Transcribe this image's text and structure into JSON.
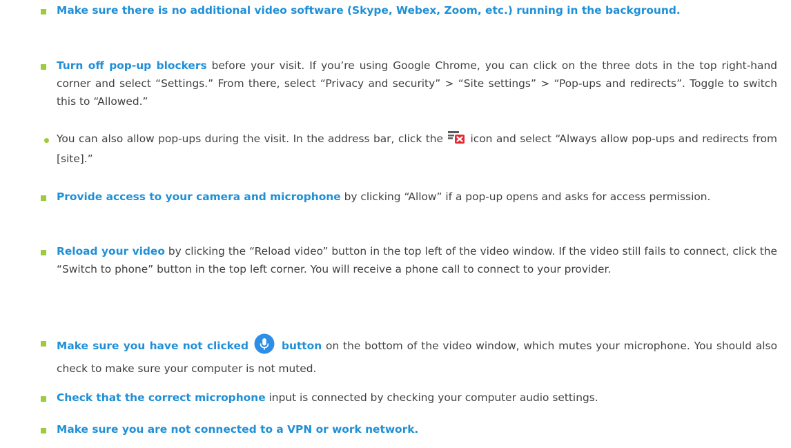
{
  "items": [
    {
      "bold": "Make sure there is no additional video software (Skype, Webex, Zoom, etc.) running in the background.",
      "text": ""
    },
    {
      "bold": "Turn off pop-up blockers",
      "text": " before your visit. If you’re using Google Chrome, you can click on the three dots in the top right-hand corner and select “Settings.” From there, select “Privacy and security” > “Site settings” > “Pop-ups and redirects”. Toggle to switch this to “Allowed.”"
    },
    {
      "sub_before": "You can also allow pop-ups during the visit. In the address bar, click the",
      "sub_after": "icon and select “Always allow pop-ups and redirects from [site].”"
    },
    {
      "bold": "Provide access to your camera and microphone",
      "text": " by clicking “Allow” if a pop-up opens and asks for access permission."
    },
    {
      "bold": "Reload your video",
      "text": " by clicking the “Reload video” button in the top left of the video window. If the video still fails to connect, click the “Switch to phone” button in the top left corner. You will receive a phone call to connect to your provider."
    },
    {
      "bold_before": "Make sure you have not clicked",
      "bold_after": "button",
      "text": " on the bottom of the video window, which mutes your microphone. You should also check to make sure your computer is not muted."
    },
    {
      "bold": "Check that the correct microphone",
      "text": " input is connected by checking your computer audio settings."
    },
    {
      "bold": "Make sure you are not connected to a VPN or work network.",
      "text": ""
    }
  ],
  "icons": {
    "popup_blocked": "popup-blocked-icon",
    "microphone": "microphone-icon"
  },
  "colors": {
    "accent_blue": "#1f8fd6",
    "bullet_green": "#9ccb3b",
    "body_text": "#404040",
    "icon_red": "#e8262e",
    "icon_gray": "#5a5a5a"
  }
}
